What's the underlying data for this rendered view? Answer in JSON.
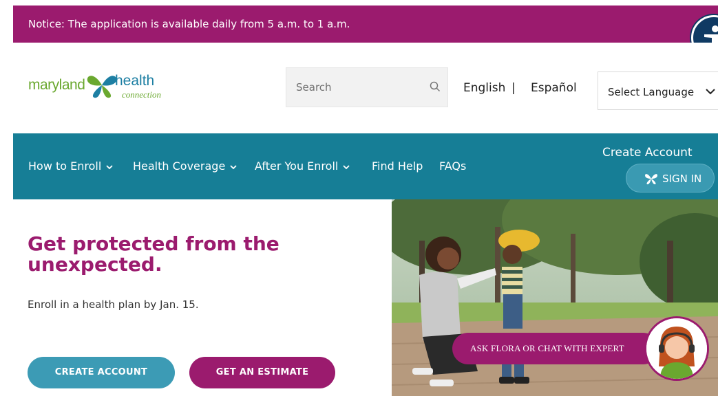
{
  "notice": {
    "text": "Notice: The application is available daily from 5 a.m. to 1 a.m."
  },
  "icons": {
    "accessibility": "accessibility-icon",
    "search": "search-icon",
    "chevron": "chevron-down-icon",
    "signin": "logo-x-icon"
  },
  "logo": {
    "word1": "maryland",
    "word2": "health",
    "word3": "connection"
  },
  "header": {
    "search_placeholder": "Search",
    "lang_english": "English",
    "lang_separator": "|",
    "lang_spanish": "Español",
    "select_language": "Select Language"
  },
  "nav": {
    "items": [
      {
        "label": "How to Enroll"
      },
      {
        "label": "Health Coverage"
      },
      {
        "label": "After You Enroll"
      },
      {
        "label": "Find Help"
      },
      {
        "label": "FAQs"
      }
    ],
    "create_account": "Create Account",
    "sign_in": "SIGN IN"
  },
  "hero": {
    "title": "Get protected from the unexpected.",
    "subtitle": "Enroll in a health plan by Jan. 15.",
    "create_button": "CREATE ACCOUNT",
    "estimate_button": "GET AN ESTIMATE"
  },
  "chat": {
    "label": "ASK FLORA OR CHAT WITH EXPERT"
  },
  "colors": {
    "brand_purple": "#9b1b6e",
    "nav_teal": "#167e96",
    "button_teal": "#3c9bb5",
    "logo_green": "#6aa82f",
    "logo_blue": "#1d7fa3"
  }
}
